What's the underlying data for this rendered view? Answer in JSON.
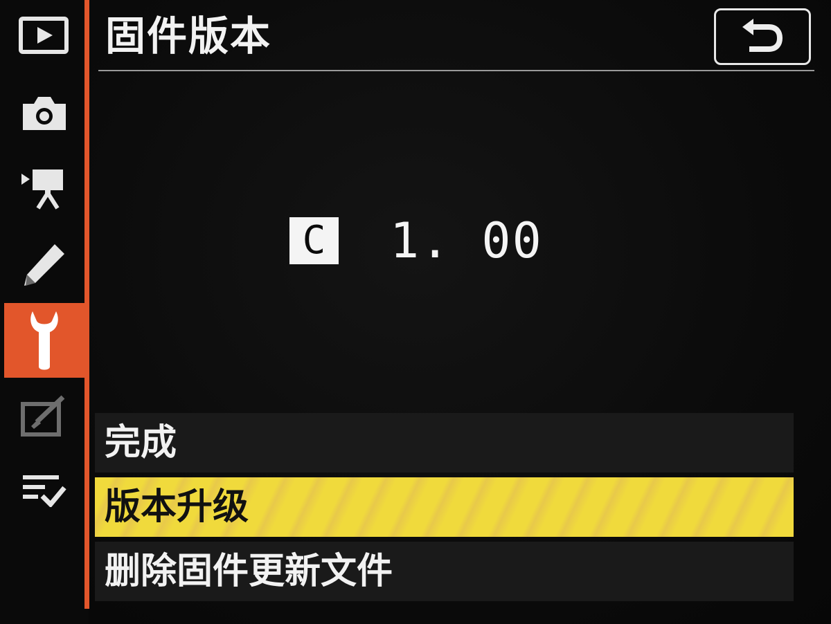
{
  "header": {
    "title": "固件版本",
    "back_icon": "return-arrow-icon"
  },
  "tabs": [
    {
      "name": "playback",
      "icon": "playback-icon",
      "active": false
    },
    {
      "name": "photo-shooting",
      "icon": "camera-icon",
      "active": false
    },
    {
      "name": "movie-shooting",
      "icon": "movie-camera-icon",
      "active": false
    },
    {
      "name": "custom-settings",
      "icon": "pencil-icon",
      "active": false
    },
    {
      "name": "setup",
      "icon": "wrench-icon",
      "active": true
    },
    {
      "name": "retouch",
      "icon": "retouch-icon",
      "active": false
    },
    {
      "name": "my-menu",
      "icon": "my-menu-icon",
      "active": false
    }
  ],
  "firmware": {
    "badge": "C",
    "version": "1. 00"
  },
  "menu": {
    "items": [
      {
        "label": "完成",
        "selected": false
      },
      {
        "label": "版本升级",
        "selected": true
      },
      {
        "label": "删除固件更新文件",
        "selected": false
      }
    ]
  },
  "colors": {
    "accent": "#e2562b",
    "highlight": "#f0da3c",
    "text": "#f2f2f2",
    "background": "#0b0b0b"
  }
}
